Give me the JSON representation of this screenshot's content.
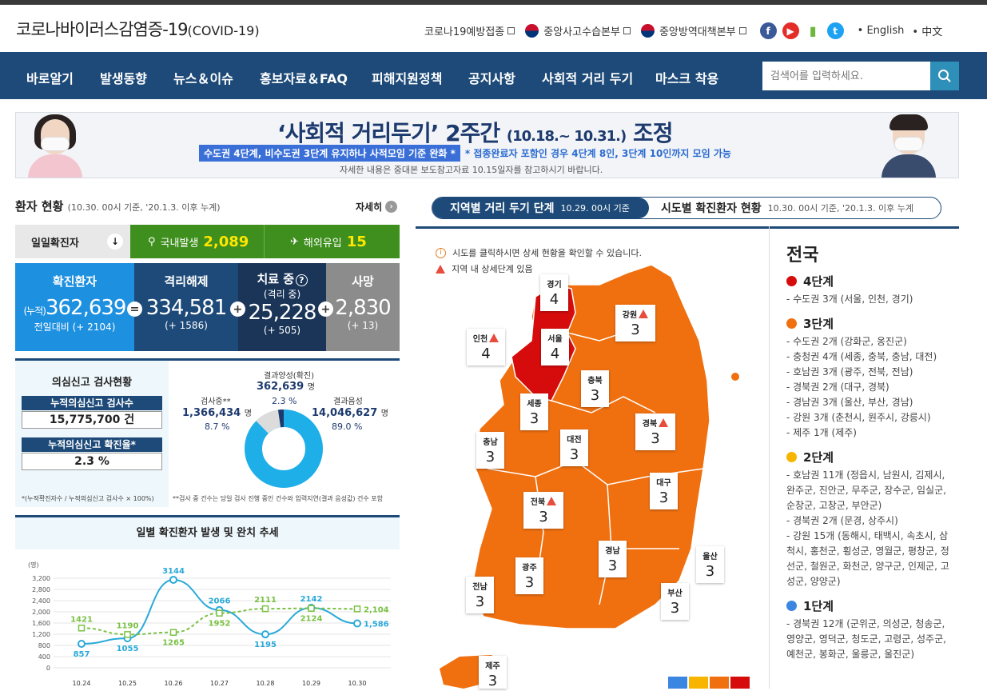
{
  "header": {
    "logo": "코로나바이러스감염증-19",
    "logo_en": "(COVID-19)",
    "links": [
      "코로나19예방접종",
      "중앙사고수습본부",
      "중앙방역대책본부"
    ],
    "lang": [
      "• English",
      "• 中文"
    ]
  },
  "nav": {
    "items": [
      "바로알기",
      "발생동향",
      "뉴스＆이슈",
      "홍보자료＆FAQ",
      "피해지원정책",
      "공지사항",
      "사회적 거리 두기",
      "마스크 착용"
    ],
    "search_placeholder": "검색어를 입력하세요."
  },
  "banner": {
    "title": "‘사회적 거리두기’ 2주간",
    "period": "(10.18.~ 10.31.)",
    "title_end": "조정",
    "pill": "수도권 4단계, 비수도권 3단계 유지하나 사적모임 기준 완화 *",
    "rest": "* 접종완료자 포함인 경우 4단계 8인, 3단계 10인까지 모임 가능",
    "note": "자세한 내용은 중대본 보도참고자료 10.15일자를 참고하시기 바랍니다."
  },
  "patients": {
    "title": "환자 현황",
    "sub": "(10.30. 00시 기준, '20.1.3. 이후 누계)",
    "more": "자세히",
    "daily_label": "일일확진자",
    "domestic_label": "국내발생",
    "domestic": "2,089",
    "import_label": "해외유입",
    "import": "15",
    "confirmed_title": "확진환자",
    "confirmed_prefix": "(누적)",
    "confirmed": "362,639",
    "confirmed_diff": "전일대비 (+ 2104)",
    "released_title": "격리해제",
    "released": "334,581",
    "released_diff": "(+ 1586)",
    "treat_title": "치료 중",
    "treat_sub": "(격리 중)",
    "treat": "25,228",
    "treat_diff": "(+ 505)",
    "death_title": "사망",
    "death": "2,830",
    "death_diff": "(+ 13)"
  },
  "tests": {
    "title": "의심신고 검사현황",
    "total_label": "누적의심신고 검사수",
    "total": "15,775,700 건",
    "rate_label": "누적의심신고 확진율*",
    "rate": "2.3 %",
    "note1": "*(누적확진자수 / 누적의심신고 검사수 × 100%)",
    "note2": "**검사 중 건수는 당일 검사 진행 중인 건수와 입력지연(결과 음성값) 건수 포함",
    "pos_label": "결과양성(확진)",
    "pos": "362,639",
    "pos_pct": "2.3 %",
    "ing_label": "검사중**",
    "ing": "1,366,434",
    "ing_pct": "8.7 %",
    "neg_label": "결과음성",
    "neg": "14,046,627",
    "neg_pct": "89.0 %",
    "unit": "명"
  },
  "chart_title": "일별 확진환자 발생 및 완치 추세",
  "chart_data": {
    "type": "line",
    "ylabel": "(명)",
    "categories": [
      "10.24",
      "10.25",
      "10.26",
      "10.27",
      "10.28",
      "10.29",
      "10.30"
    ],
    "yticks": [
      0,
      400,
      800,
      1200,
      1600,
      2000,
      2400,
      2800,
      3200
    ],
    "ylim": [
      0,
      3200
    ],
    "series": [
      {
        "values": [
          857,
          1055,
          3144,
          2066,
          1195,
          2142,
          1586
        ],
        "labels": [
          "857",
          "1055",
          "3144",
          "2066",
          "1195",
          "2142",
          "1,586"
        ],
        "color": "#29a9d8"
      },
      {
        "values": [
          1421,
          1190,
          1265,
          1952,
          2111,
          2124,
          2104
        ],
        "labels": [
          "1421",
          "1190",
          "1265",
          "1952",
          "2111",
          "2124",
          "2,104"
        ],
        "color": "#7ac143"
      }
    ]
  },
  "map": {
    "tab1": "지역별 거리 두기 단계",
    "tab1_sub": "10.29. 00시 기준",
    "tab2": "시도별 확진환자 현황",
    "tab2_sub": "10.30. 00시 기준, '20.1.3. 이후 누계",
    "note1": "시도를 클릭하시면 상세 현황을 확인할 수 있습니다.",
    "note2": "지역 내 상세단계 있음",
    "regions": [
      {
        "n": "경기",
        "l": "4"
      },
      {
        "n": "서울",
        "l": "4"
      },
      {
        "n": "인천",
        "l": "4"
      },
      {
        "n": "강원",
        "l": "3"
      },
      {
        "n": "충북",
        "l": "3"
      },
      {
        "n": "세종",
        "l": "3"
      },
      {
        "n": "경북",
        "l": "3"
      },
      {
        "n": "대전",
        "l": "3"
      },
      {
        "n": "충남",
        "l": "3"
      },
      {
        "n": "대구",
        "l": "3"
      },
      {
        "n": "전북",
        "l": "3"
      },
      {
        "n": "경남",
        "l": "3"
      },
      {
        "n": "울산",
        "l": "3"
      },
      {
        "n": "광주",
        "l": "3"
      },
      {
        "n": "전남",
        "l": "3"
      },
      {
        "n": "부산",
        "l": "3"
      },
      {
        "n": "제주",
        "l": "3"
      }
    ]
  },
  "levels": {
    "title": "전국",
    "l4": "4단계",
    "l4d": "- 수도권 3개 (서울, 인천, 경기)",
    "l3": "3단계",
    "l3d": "- 수도권 2개 (강화군, 옹진군)<br>- 충청권 4개 (세종, 충북, 충남, 대전)<br>- 호남권 3개 (광주, 전북, 전남)<br>- 경북권 2개 (대구, 경북)<br>- 경남권 3개 (울산, 부산, 경남)<br>- 강원 3개 (춘천시, 원주시, 강릉시)<br>- 제주 1개 (제주)",
    "l2": "2단계",
    "l2d": "- 호남권 11개 (정읍시, 남원시, 김제시, 완주군, 진안군, 무주군, 장수군, 임실군, 순창군, 고창군, 부안군)<br>- 경북권 2개 (문경, 상주시)<br>- 강원 15개 (동해시, 태백시, 속초시, 삼척시, 홍천군, 횡성군, 영월군, 평창군, 정선군, 철원군, 화천군, 양구군, 인제군, 고성군, 양양군)",
    "l1": "1단계",
    "l1d": "- 경북권 12개 (군위군, 의성군, 청송군, 영양군, 영덕군, 청도군, 고령군, 성주군, 예천군, 봉화군, 울릉군, 울진군)"
  }
}
